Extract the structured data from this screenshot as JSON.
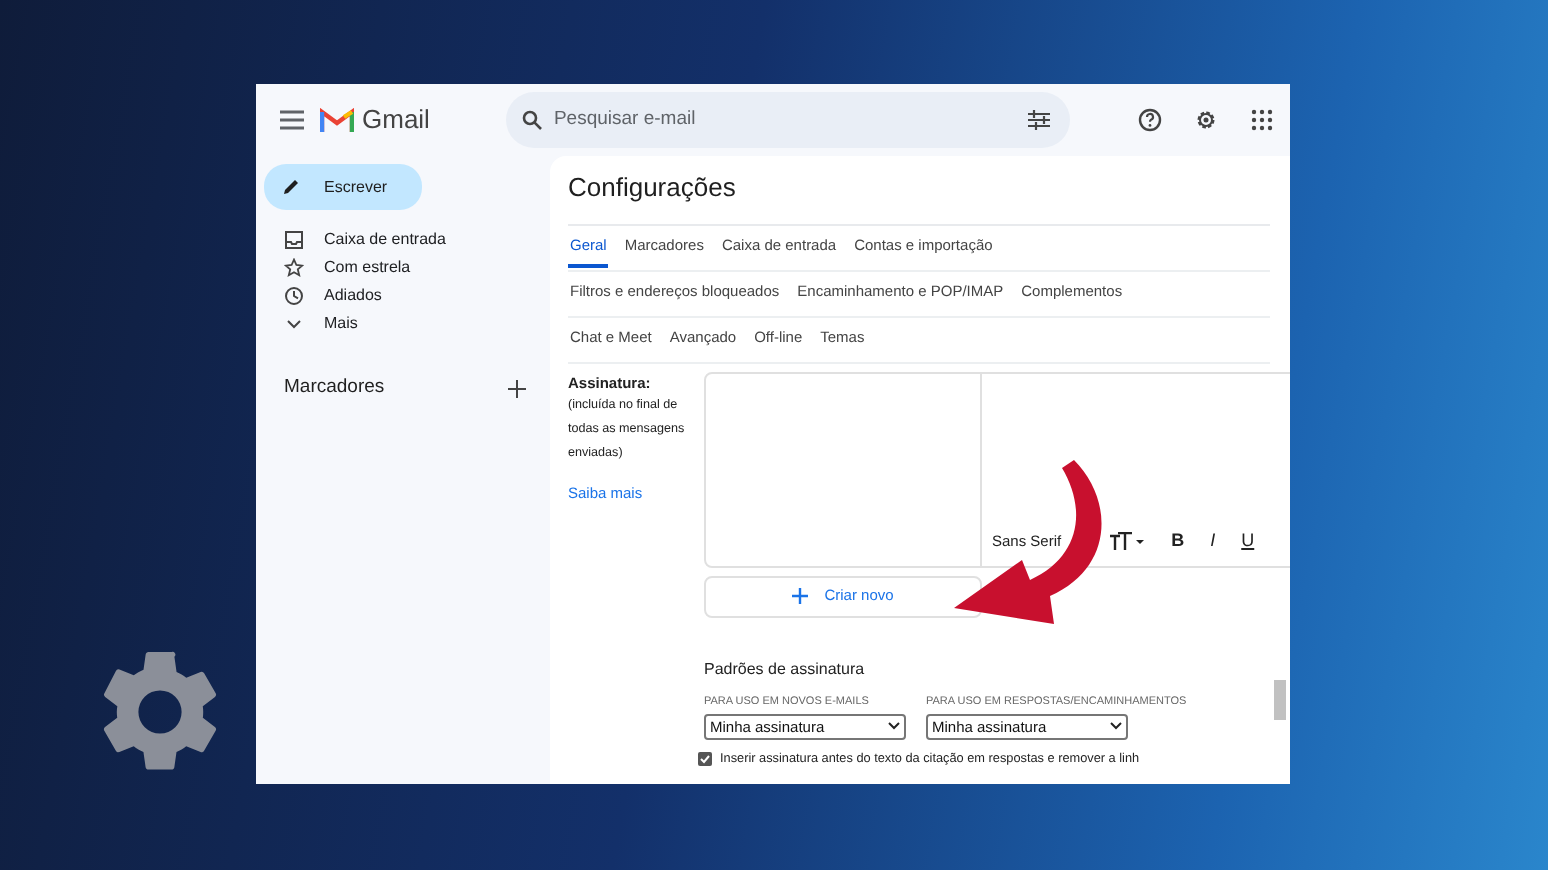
{
  "app": {
    "name": "Gmail"
  },
  "search": {
    "placeholder": "Pesquisar e-mail"
  },
  "compose": {
    "label": "Escrever"
  },
  "sidebar": {
    "items": [
      {
        "label": "Caixa de entrada",
        "kind": "inbox"
      },
      {
        "label": "Com estrela",
        "kind": "star"
      },
      {
        "label": "Adiados",
        "kind": "clock"
      },
      {
        "label": "Mais",
        "kind": "more"
      }
    ],
    "labels_heading": "Marcadores"
  },
  "settings": {
    "title": "Configurações",
    "tab_rows": [
      [
        {
          "label": "Geral",
          "selected": true
        },
        {
          "label": "Marcadores",
          "selected": false
        },
        {
          "label": "Caixa de entrada",
          "selected": false
        },
        {
          "label": "Contas e importação",
          "selected": false
        }
      ],
      [
        {
          "label": "Filtros e endereços bloqueados",
          "selected": false
        },
        {
          "label": "Encaminhamento e POP/IMAP",
          "selected": false
        },
        {
          "label": "Complementos",
          "selected": false
        }
      ],
      [
        {
          "label": "Chat e Meet",
          "selected": false
        },
        {
          "label": "Avançado",
          "selected": false
        },
        {
          "label": "Off-line",
          "selected": false
        },
        {
          "label": "Temas",
          "selected": false
        }
      ]
    ]
  },
  "signature": {
    "label": "Assinatura:",
    "note": "(incluída no final de todas as mensagens enviadas)",
    "link": "Saiba mais",
    "font": "Sans Serif",
    "format_buttons": [
      "B",
      "I",
      "U"
    ],
    "create_button": "Criar novo"
  },
  "defaults": {
    "title": "Padrões de assinatura",
    "fields": [
      {
        "label": "PARA USO EM NOVOS E-MAILS",
        "value": "Minha assinatura"
      },
      {
        "label": "PARA USO EM RESPOSTAS/ENCAMINHAMENTOS",
        "value": "Minha assinatura"
      }
    ]
  },
  "insert_option": {
    "label": "Inserir assinatura antes do texto da citação em respostas e remover a linh",
    "checked": true
  }
}
